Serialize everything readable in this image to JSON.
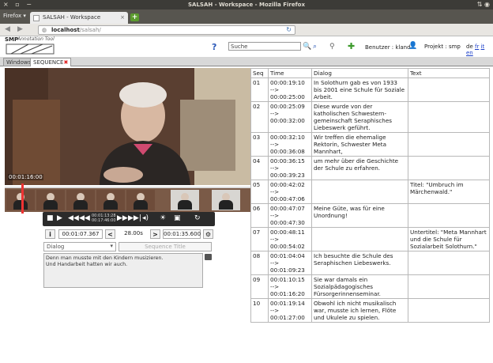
{
  "os": {
    "window_title": "SALSAH - Workspace - Mozilla Firefox",
    "controls": "× ▫ −",
    "tray": "⇅ ◉"
  },
  "browser": {
    "menu": "Firefox ▾",
    "tab_title": "SALSAH - Workspace",
    "url_host": "localhost",
    "url_path": "/salsah/"
  },
  "app": {
    "logo_primary": "SMP",
    "logo_secondary": "Annotation Tool",
    "search_label": "Suche",
    "user_label": "Benutzer : kland",
    "project_label": "Projekt : smp",
    "lang_de": "de",
    "lang_fr": "fr",
    "lang_it": "it",
    "lang_en": "en"
  },
  "subtabs": [
    {
      "label": "Windows"
    },
    {
      "label": "SEQUENCE"
    }
  ],
  "player": {
    "current_timecode": "00:01:16:00",
    "range_time_top": "00:01:13:28",
    "range_time_bottom": "00:17:46:00",
    "start_time": "00:01:07.367",
    "duration": "28.00s",
    "end_time": "00:01:35.600",
    "dialog_select": "Dialog",
    "sequence_title_placeholder": "Sequence Title",
    "notes_line1": "Denn man musste mit den Kindern musizieren.",
    "notes_line2": "Und Handarbeit hatten wir auch."
  },
  "table": {
    "headers": {
      "seq": "Seq",
      "time": "Time",
      "dialog": "Dialog",
      "text": "Text"
    },
    "rows": [
      {
        "seq": "01",
        "t1": "00:00:19:10",
        "arrow": "-->",
        "t2": "00:00:25:00",
        "dialog": "In Solothurn gab es von 1933 bis 2001 eine Schule für Soziale Arbeit.",
        "text": ""
      },
      {
        "seq": "02",
        "t1": "00:00:25:09",
        "arrow": "-->",
        "t2": "00:00:32:00",
        "dialog": "Diese wurde von der katholischen Schwestern-gemeinschaft Seraphisches Liebeswerk geführt.",
        "text": ""
      },
      {
        "seq": "03",
        "t1": "00:00:32:10",
        "arrow": "-->",
        "t2": "00:00:36:08",
        "dialog": "Wir treffen die ehemalige Rektorin, Schwester Meta Mannhart,",
        "text": ""
      },
      {
        "seq": "04",
        "t1": "00:00:36:15",
        "arrow": "-->",
        "t2": "00:00:39:23",
        "dialog": "um mehr über die Geschichte der Schule zu erfahren.",
        "text": ""
      },
      {
        "seq": "05",
        "t1": "00:00:42:02",
        "arrow": "-->",
        "t2": "00:00:47:06",
        "dialog": "",
        "text": "Titel: \"Umbruch im Märchenwald.\""
      },
      {
        "seq": "06",
        "t1": "00:00:47:07",
        "arrow": "-->",
        "t2": "00:00:47:30",
        "dialog": "Meine Güte, was für eine Unordnung!",
        "text": ""
      },
      {
        "seq": "07",
        "t1": "00:00:48:11",
        "arrow": "-->",
        "t2": "00:00:54:02",
        "dialog": "",
        "text": "Untertitel: \"Meta Mannhart und die Schule für Sozialarbeit Solothurn.\""
      },
      {
        "seq": "08",
        "t1": "00:01:04:04",
        "arrow": "-->",
        "t2": "00:01:09:23",
        "dialog": "Ich besuchte die Schule des Seraphischen Liebeswerks.",
        "text": ""
      },
      {
        "seq": "09",
        "t1": "00:01:10:15",
        "arrow": "-->",
        "t2": "00:01:16:20",
        "dialog": "Sie war damals ein Sozialpädagogisches Fürsorgerinnenseminar.",
        "text": ""
      },
      {
        "seq": "10",
        "t1": "00:01:19:14",
        "arrow": "-->",
        "t2": "00:01:27:00",
        "dialog": "Obwohl ich nicht musikalisch war, musste ich lernen, Flöte und Ukulele zu spielen.",
        "text": ""
      }
    ]
  },
  "colors": {
    "accent_green": "#5b9b2e",
    "help_blue": "#2a58b8",
    "close_red": "#e02020"
  },
  "icons": [
    "help-icon",
    "search-icon",
    "zoom-icon",
    "link-icon",
    "add-icon",
    "user-icon",
    "play-icon",
    "stop-icon"
  ]
}
